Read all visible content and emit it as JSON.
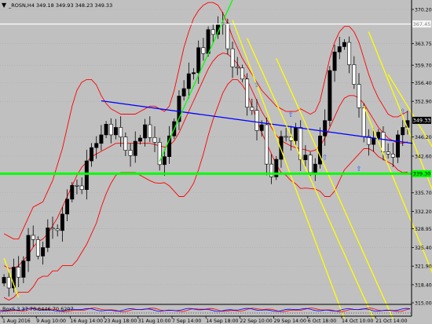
{
  "window": {
    "symbol_title": "_ROSN,H4  349.18 349.93 348.23 349.33",
    "indicator_title": "BoxS 3 37 70.6446 70.6207",
    "background_color": "#c0c0c0"
  },
  "chart_data": {
    "type": "candlestick",
    "title": "_ROSN,H4  349.18 349.93 348.23 349.33",
    "ohlc": {
      "open": 349.18,
      "high": 349.93,
      "low": 348.23,
      "close": 349.33
    },
    "x_tick_labels": [
      "1 Aug 2016",
      "9 Aug 10:00",
      "16 Aug 14:00",
      "23 Aug 18:00",
      "31 Aug 10:00",
      "7 Sep 14:00",
      "14 Sep 18:00",
      "22 Sep 10:00",
      "29 Sep 14:00",
      "6 Oct 18:00",
      "14 Oct 10:00",
      "21 Oct 14:00"
    ],
    "y_tick_labels": [
      "370.20",
      "363.75",
      "359.70",
      "356.40",
      "352.90",
      "346.20",
      "342.60",
      "335.70",
      "332.20",
      "328.95",
      "325.40",
      "321.90",
      "318.40",
      "315.00"
    ],
    "ylim": [
      315.0,
      370.2
    ],
    "price_labels": {
      "current": "349.33",
      "white_line": "367.45",
      "green_line": "339.30"
    },
    "horizontal_levels": {
      "white": 367.45,
      "green": 339.3
    },
    "candles": {
      "open": [
        318.7,
        319.8,
        317.8,
        321.7,
        319.8,
        322.9,
        327.7,
        326.9,
        323.8,
        325.4,
        329.1,
        328.9,
        328.6,
        331.7,
        334.5,
        337.1,
        337.0,
        336.3,
        341.7,
        344.2,
        345.0,
        346.6,
        348.6,
        346.6,
        348.0,
        346.2,
        343.7,
        342.7,
        345.4,
        346.0,
        348.5,
        346.1,
        345.2,
        341.0,
        342.5,
        346.4,
        349.1,
        353.9,
        355.3,
        358.1,
        358.3,
        363.0,
        361.9,
        366.4,
        365.5,
        367.3,
        367.6,
        362.8,
        359.4,
        359.2,
        357.1,
        351.8,
        351.2,
        347.4,
        348.5,
        341.1,
        338.7,
        342.0,
        346.3,
        346.2,
        345.5,
        348.0,
        341.9,
        342.8,
        339.5,
        341.1,
        346.4,
        349.3,
        358.7,
        362.2,
        363.2,
        364.0,
        359.8,
        356.1,
        351.7,
        346.3,
        344.8,
        346.0,
        347.1,
        343.4,
        343.0,
        342.4,
        346.6,
        348.0
      ],
      "close": [
        319.8,
        317.8,
        321.7,
        319.8,
        322.9,
        327.7,
        326.9,
        323.8,
        325.4,
        329.1,
        328.9,
        328.6,
        331.7,
        334.5,
        337.1,
        337.0,
        336.3,
        341.7,
        344.2,
        345.0,
        346.6,
        348.6,
        346.6,
        348.0,
        346.2,
        343.7,
        342.7,
        345.4,
        346.0,
        348.5,
        346.1,
        345.2,
        341.0,
        342.5,
        346.4,
        349.1,
        353.9,
        355.3,
        358.1,
        358.3,
        363.0,
        361.9,
        366.4,
        365.5,
        367.3,
        367.6,
        362.8,
        359.4,
        359.2,
        357.1,
        351.8,
        351.2,
        347.4,
        348.5,
        341.1,
        338.7,
        342.0,
        346.3,
        346.2,
        345.5,
        348.0,
        341.9,
        342.8,
        339.5,
        341.1,
        346.4,
        349.3,
        358.7,
        362.2,
        363.2,
        364.0,
        359.8,
        356.1,
        351.7,
        346.3,
        344.8,
        346.0,
        347.1,
        343.4,
        343.0,
        342.4,
        346.6,
        348.0,
        349.3
      ]
    },
    "bollinger": {
      "upper": [
        328.0,
        327.5,
        327.0,
        327.0,
        329.0,
        331.0,
        333.0,
        333.5,
        334.0,
        336.0,
        338.0,
        341.0,
        344.0,
        348.0,
        352.0,
        355.0,
        356.5,
        357.0,
        357.0,
        356.0,
        354.0,
        352.5,
        351.5,
        351.0,
        350.5,
        350.5,
        350.5,
        350.5,
        351.0,
        351.5,
        352.0,
        352.0,
        351.5,
        351.0,
        352.0,
        355.0,
        359.0,
        363.0,
        366.0,
        368.5,
        370.0,
        371.0,
        371.5,
        371.5,
        371.0,
        369.5,
        367.5,
        365.0,
        363.0,
        361.0,
        359.5,
        358.0,
        356.5,
        355.0,
        354.0,
        353.0,
        352.0,
        351.5,
        351.0,
        351.0,
        351.0,
        351.5,
        351.0,
        350.5,
        351.0,
        353.0,
        357.0,
        361.0,
        364.0,
        366.0,
        367.0,
        367.0,
        366.0,
        364.0,
        361.0,
        358.0,
        355.5,
        353.5,
        352.0,
        350.5,
        350.0,
        350.0,
        350.5,
        351.0
      ],
      "middle": [
        322.0,
        321.5,
        321.5,
        322.0,
        323.0,
        324.0,
        325.5,
        326.5,
        327.0,
        328.0,
        329.5,
        331.0,
        333.0,
        335.0,
        337.0,
        339.0,
        340.5,
        341.5,
        342.5,
        343.0,
        343.5,
        344.0,
        344.5,
        345.0,
        345.0,
        345.0,
        345.0,
        345.0,
        345.0,
        345.0,
        345.0,
        344.8,
        344.5,
        344.3,
        344.5,
        345.5,
        347.0,
        349.0,
        351.0,
        353.0,
        355.0,
        357.0,
        359.0,
        360.5,
        361.5,
        362.0,
        361.8,
        361.0,
        360.0,
        358.5,
        357.0,
        355.0,
        353.0,
        351.0,
        349.5,
        348.0,
        346.5,
        345.5,
        345.0,
        344.5,
        344.2,
        344.0,
        343.8,
        343.5,
        343.7,
        344.5,
        346.0,
        348.0,
        350.0,
        352.0,
        353.5,
        354.0,
        354.0,
        353.5,
        352.5,
        351.0,
        349.5,
        348.0,
        347.0,
        346.0,
        345.5,
        345.0,
        345.0,
        345.3
      ],
      "lower": [
        316.0,
        315.5,
        316.0,
        317.0,
        317.0,
        317.0,
        318.0,
        319.5,
        320.0,
        320.0,
        321.0,
        321.0,
        322.0,
        322.0,
        322.0,
        323.0,
        324.5,
        326.0,
        328.0,
        330.0,
        333.0,
        335.5,
        337.5,
        339.0,
        339.5,
        339.5,
        339.5,
        339.5,
        339.0,
        338.5,
        338.0,
        337.6,
        337.5,
        337.6,
        337.0,
        336.0,
        335.0,
        335.0,
        336.0,
        337.5,
        340.0,
        343.0,
        346.5,
        349.5,
        352.0,
        354.5,
        356.1,
        357.0,
        357.0,
        356.0,
        354.5,
        352.0,
        349.5,
        347.0,
        345.0,
        343.0,
        341.0,
        339.5,
        339.0,
        338.0,
        337.4,
        336.5,
        336.6,
        336.5,
        336.4,
        336.0,
        335.0,
        335.0,
        336.0,
        338.0,
        340.0,
        341.0,
        342.0,
        343.0,
        344.0,
        344.0,
        343.5,
        342.5,
        342.0,
        341.5,
        341.0,
        340.0,
        339.5,
        339.6
      ]
    },
    "trend_lines": [
      {
        "color": "#0000ff",
        "from": {
          "x": 20,
          "y": 353.0
        },
        "to": {
          "x": 84,
          "y": 345.0
        }
      },
      {
        "color": "#00ff00",
        "from": {
          "x": 32,
          "y": 341.6
        },
        "to": {
          "x": 47,
          "y": 372.0
        }
      },
      {
        "color": "#ffff00",
        "from": {
          "x": 47,
          "y": 368.2
        },
        "to": {
          "x": 70,
          "y": 312.0
        }
      },
      {
        "color": "#ffff00",
        "from": {
          "x": 50,
          "y": 364.8
        },
        "to": {
          "x": 76,
          "y": 312.0
        }
      },
      {
        "color": "#ffff00",
        "from": {
          "x": 56,
          "y": 361.0
        },
        "to": {
          "x": 80,
          "y": 312.0
        }
      },
      {
        "color": "#ffff00",
        "from": {
          "x": 75,
          "y": 366.0
        },
        "to": {
          "x": 96,
          "y": 318.4
        }
      },
      {
        "color": "#ffff00",
        "from": {
          "x": 79,
          "y": 358.0
        },
        "to": {
          "x": 96,
          "y": 332.5
        }
      },
      {
        "color": "#ffff00",
        "from": {
          "x": 74,
          "y": 352.0
        },
        "to": {
          "x": 92,
          "y": 312.0
        }
      },
      {
        "color": "#ffff00",
        "from": {
          "x": 0,
          "y": 323.4
        },
        "to": {
          "x": 3,
          "y": 316.0
        }
      }
    ],
    "arrow_markers": [
      {
        "i": 52,
        "price": 355.6
      },
      {
        "i": 59,
        "price": 350.0
      },
      {
        "i": 66,
        "price": 341.9
      },
      {
        "i": 73,
        "price": 339.8
      },
      {
        "i": 82,
        "price": 350.6
      },
      {
        "i": 89,
        "price": 341.7
      }
    ]
  }
}
